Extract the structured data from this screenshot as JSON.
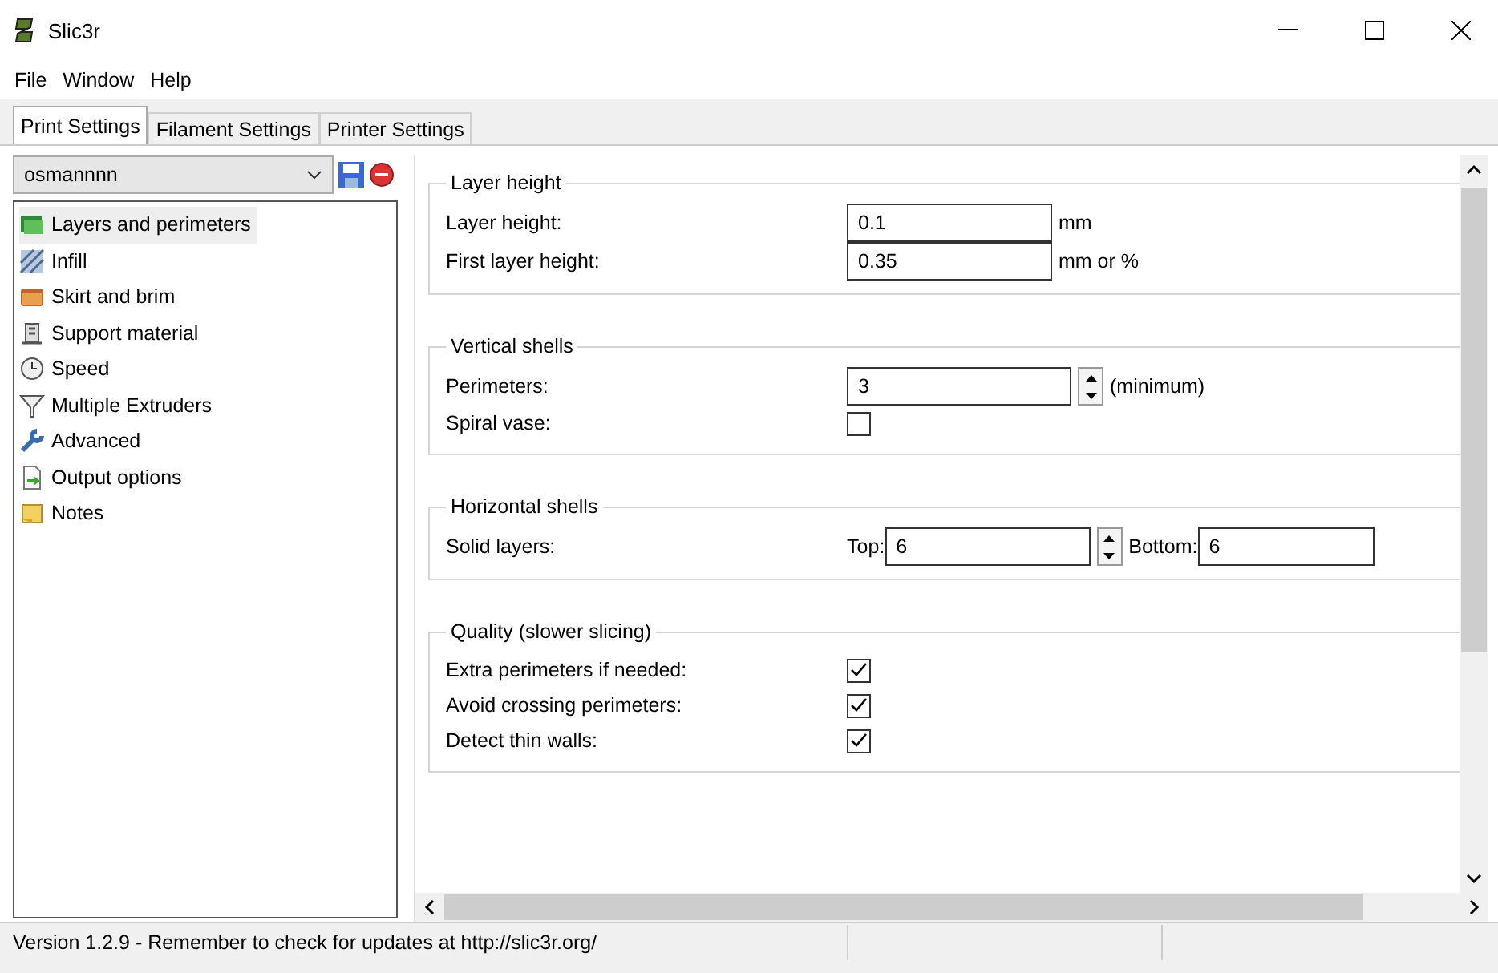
{
  "window": {
    "title": "Slic3r"
  },
  "menu": [
    "File",
    "Window",
    "Help"
  ],
  "tabs": [
    {
      "label": "Print Settings",
      "selected": true
    },
    {
      "label": "Filament Settings",
      "selected": false
    },
    {
      "label": "Printer Settings",
      "selected": false
    }
  ],
  "preset": {
    "value": "osmannnn"
  },
  "sidebar": {
    "items": [
      {
        "label": "Layers and perimeters",
        "selected": true
      },
      {
        "label": "Infill",
        "selected": false
      },
      {
        "label": "Skirt and brim",
        "selected": false
      },
      {
        "label": "Support material",
        "selected": false
      },
      {
        "label": "Speed",
        "selected": false
      },
      {
        "label": "Multiple Extruders",
        "selected": false
      },
      {
        "label": "Advanced",
        "selected": false
      },
      {
        "label": "Output options",
        "selected": false
      },
      {
        "label": "Notes",
        "selected": false
      }
    ]
  },
  "sections": [
    {
      "title": "Layer height",
      "rows": [
        {
          "kind": "text",
          "label": "Layer height:",
          "value": "0.1",
          "unit": "mm"
        },
        {
          "kind": "text",
          "label": "First layer height:",
          "value": "0.35",
          "unit": "mm or %"
        }
      ]
    },
    {
      "title": "Vertical shells",
      "rows": [
        {
          "kind": "spin",
          "label": "Perimeters:",
          "value": "3",
          "unit": "(minimum)"
        },
        {
          "kind": "checkbox",
          "label": "Spiral vase:",
          "checked": false
        }
      ]
    },
    {
      "title": "Horizontal shells",
      "rows": [
        {
          "kind": "pair",
          "label": "Solid layers:",
          "first_label": "Top:",
          "first_value": "6",
          "second_label": "Bottom:",
          "second_value": "6"
        }
      ]
    },
    {
      "title": "Quality (slower slicing)",
      "rows": [
        {
          "kind": "checkbox",
          "label": "Extra perimeters if needed:",
          "checked": true
        },
        {
          "kind": "checkbox",
          "label": "Avoid crossing perimeters:",
          "checked": true
        },
        {
          "kind": "checkbox",
          "label": "Detect thin walls:",
          "checked": true
        }
      ]
    }
  ],
  "status_bar": {
    "text": "Version 1.2.9 - Remember to check for updates at http://slic3r.org/"
  }
}
